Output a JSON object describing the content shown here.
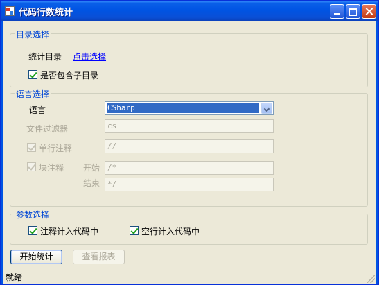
{
  "window": {
    "title": "代码行数统计"
  },
  "dir_group": {
    "title": "目录选择",
    "dir_label": "统计目录",
    "pick_link": "点击选择",
    "include_sub_label": "是否包含子目录",
    "include_sub_checked": true
  },
  "lang_group": {
    "title": "语言选择",
    "lang_label": "语言",
    "lang_selected": "CSharp",
    "filter_label": "文件过滤器",
    "filter_value": "cs",
    "line_comment_label": "单行注释",
    "line_comment_checked": true,
    "line_comment_value": "//",
    "block_comment_label": "块注释",
    "block_comment_checked": true,
    "start_label": "开始",
    "start_value": "/*",
    "end_label": "结束",
    "end_value": "*/"
  },
  "param_group": {
    "title": "参数选择",
    "count_comments_label": "注释计入代码中",
    "count_comments_checked": true,
    "count_blank_label": "空行计入代码中",
    "count_blank_checked": true
  },
  "actions": {
    "start_label": "开始统计",
    "report_label": "查看报表"
  },
  "status": {
    "text": "就绪"
  },
  "colors": {
    "title_bar": "#0054e3",
    "group_title": "#0046d5",
    "link": "#0000ff",
    "selection": "#316ac5"
  }
}
